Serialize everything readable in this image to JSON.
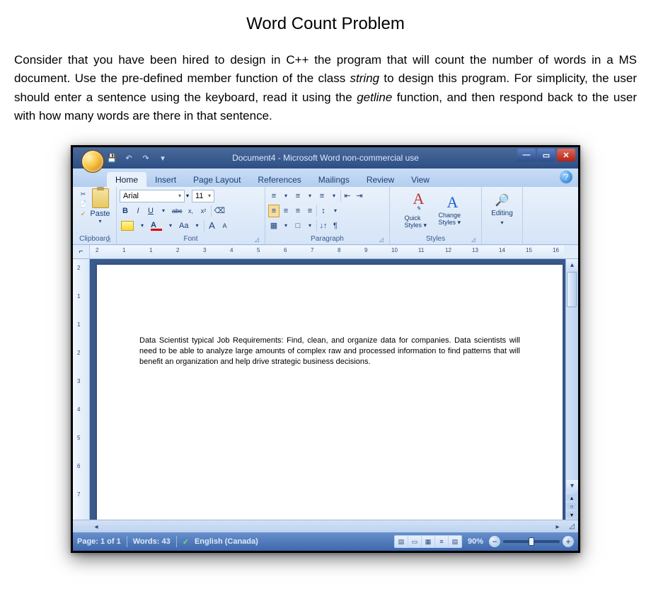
{
  "page": {
    "title": "Word Count Problem",
    "body_1": "Consider that you have been hired to design in C++ the program that will count the number of words in a MS document. Use the pre-defined member function of the class ",
    "body_em1": "string",
    "body_2": " to design this program. For simplicity, the user should enter a sentence using the keyboard, read it using the ",
    "body_em2": "getline",
    "body_3": " function, and then respond back to the user with how many words are there in that sentence."
  },
  "word": {
    "window_title": "Document4 - Microsoft Word non-commercial use",
    "qat": {
      "save": "💾",
      "undo": "↶",
      "redo": "↷",
      "more": "▾"
    },
    "tabs": {
      "home": "Home",
      "insert": "Insert",
      "page_layout": "Page Layout",
      "references": "References",
      "mailings": "Mailings",
      "review": "Review",
      "view": "View"
    },
    "ribbon": {
      "clipboard": {
        "label": "Clipboard",
        "paste": "Paste",
        "cut": "✂",
        "copy": "📄",
        "fmt": "✓"
      },
      "font": {
        "label": "Font",
        "name": "Arial",
        "size": "11",
        "bold": "B",
        "italic": "I",
        "underline": "U",
        "strike": "abc",
        "sub": "x,",
        "sup": "x²",
        "clear": "⌫",
        "hilite": "ab",
        "color": "A",
        "case": "Aa",
        "grow": "A",
        "shrink": "A"
      },
      "paragraph": {
        "label": "Paragraph",
        "bullets": "≡",
        "numbers": "≡",
        "multilevel": "≡",
        "dec_ind": "⇤",
        "inc_ind": "⇥",
        "left": "≡",
        "center": "≡",
        "right": "≡",
        "justify": "≡",
        "linesp": "↕",
        "shade": "▦",
        "border": "□",
        "sort": "↓↑",
        "marks": "¶"
      },
      "styles": {
        "label": "Styles",
        "quick": "Quick Styles ▾",
        "change": "Change Styles ▾"
      },
      "editing": {
        "label": "Editing",
        "find": "🔎"
      }
    },
    "ruler_nums": [
      "2",
      "1",
      "1",
      "2",
      "3",
      "4",
      "5",
      "6",
      "7",
      "8",
      "9",
      "10",
      "11",
      "12",
      "13",
      "14",
      "15",
      "16"
    ],
    "vruler_nums": [
      "2",
      "1",
      "1",
      "2",
      "3",
      "4",
      "5",
      "6",
      "7"
    ],
    "doc_text": "Data Scientist typical Job Requirements: Find, clean, and organize data for companies. Data scientists will need to be able to analyze large amounts of complex raw and processed information to find patterns that will benefit an organization and help drive strategic business decisions.",
    "status": {
      "page": "Page: 1 of 1",
      "words": "Words: 43",
      "check": "✓",
      "lang": "English (Canada)",
      "zoom_pct": "90%"
    }
  }
}
